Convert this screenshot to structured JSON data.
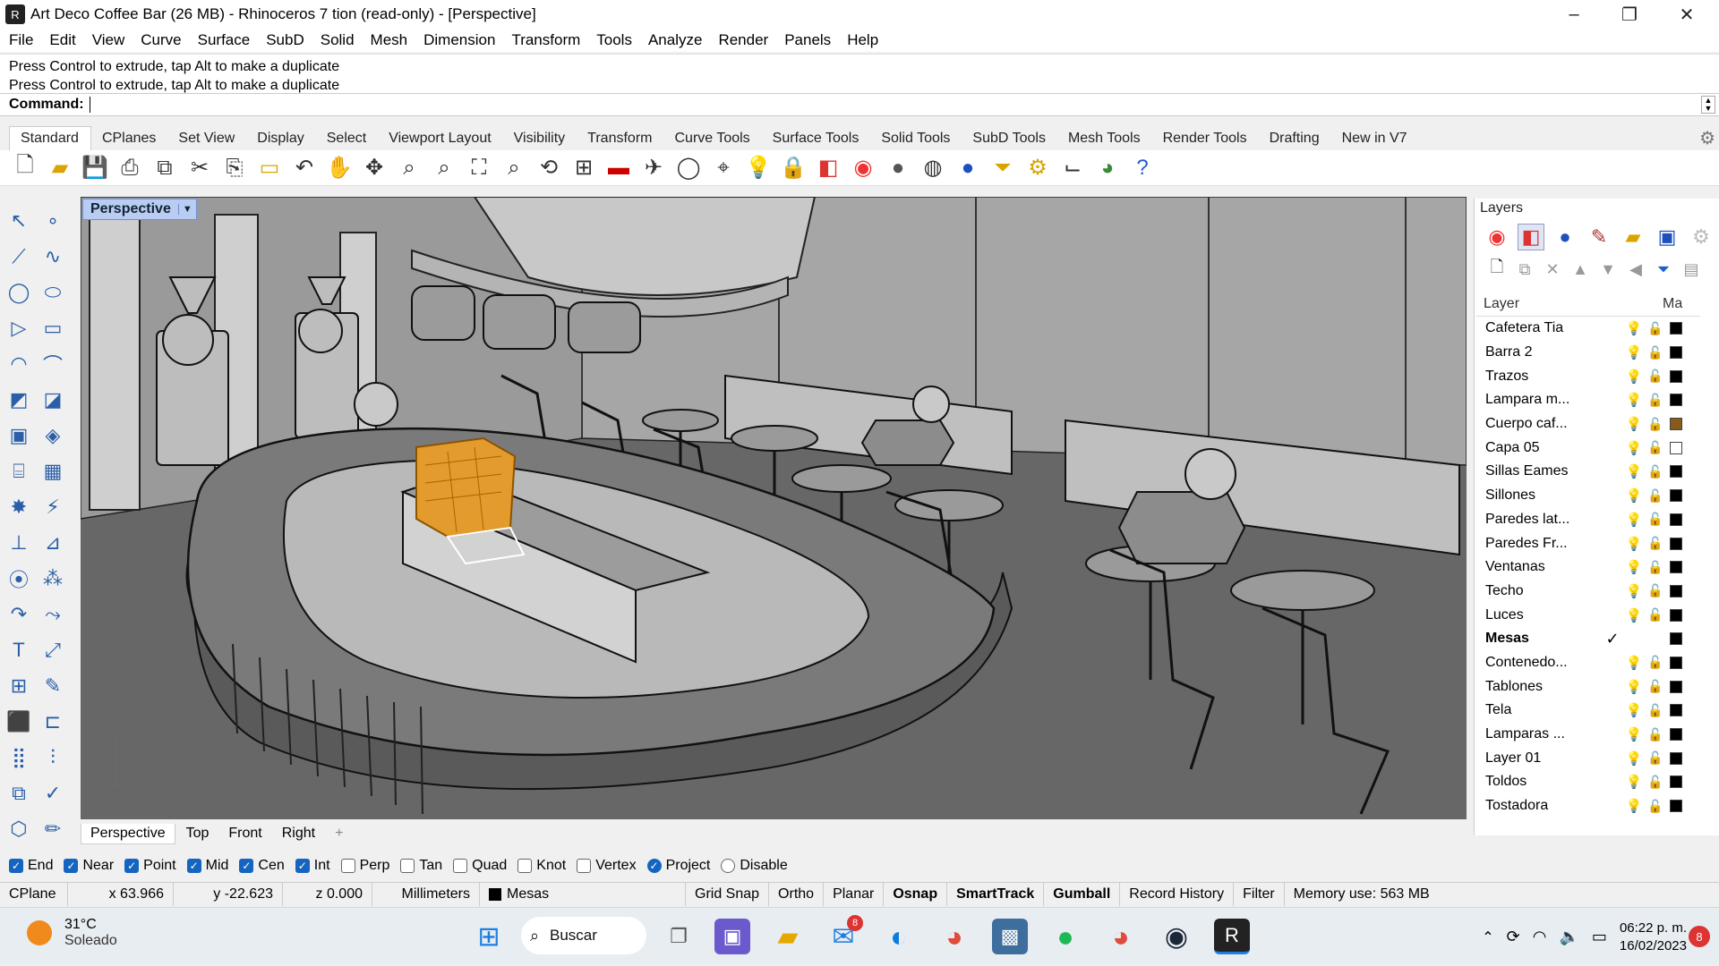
{
  "window": {
    "title": "Art Deco Coffee Bar (26 MB) - Rhinoceros 7 tion (read-only) - [Perspective]",
    "minimize": "–",
    "maximize": "❐",
    "close": "✕"
  },
  "menu": [
    "File",
    "Edit",
    "View",
    "Curve",
    "Surface",
    "SubD",
    "Solid",
    "Mesh",
    "Dimension",
    "Transform",
    "Tools",
    "Analyze",
    "Render",
    "Panels",
    "Help"
  ],
  "command": {
    "history": [
      "Press Control to extrude, tap Alt to make a duplicate",
      "Press Control to extrude, tap Alt to make a duplicate"
    ],
    "label": "Command:"
  },
  "toolbar_tabs": [
    "Standard",
    "CPlanes",
    "Set View",
    "Display",
    "Select",
    "Viewport Layout",
    "Visibility",
    "Transform",
    "Curve Tools",
    "Surface Tools",
    "Solid Tools",
    "SubD Tools",
    "Mesh Tools",
    "Render Tools",
    "Drafting",
    "New in V7"
  ],
  "toolbar_icons": [
    "new-file",
    "open-folder",
    "save",
    "print",
    "import",
    "cut",
    "copy",
    "paste",
    "undo",
    "pan-hand",
    "rotate",
    "zoom",
    "zoom-window",
    "zoom-extents",
    "zoom-selected",
    "rotate-view",
    "four-viewports",
    "car",
    "plane",
    "cplane",
    "object-snap",
    "light-bulb",
    "lock",
    "layers",
    "color-wheel",
    "material-ball",
    "rendered-ball",
    "blue-ball",
    "filter",
    "gear",
    "dimensions",
    "globe",
    "help"
  ],
  "viewport": {
    "name": "Perspective",
    "tabs": [
      "Perspective",
      "Top",
      "Front",
      "Right"
    ],
    "add_tab": "+"
  },
  "layers_panel": {
    "title": "Layers",
    "col_layer": "Layer",
    "col_material": "Ma",
    "current_check": "✓",
    "rows": [
      {
        "name": "Cafetera Tia",
        "color": "#000000"
      },
      {
        "name": "Barra 2",
        "color": "#000000"
      },
      {
        "name": "Trazos",
        "color": "#000000"
      },
      {
        "name": "Lampara m...",
        "color": "#000000"
      },
      {
        "name": "Cuerpo caf...",
        "color": "#8a5a1a"
      },
      {
        "name": "Capa 05",
        "color": "#ffffff"
      },
      {
        "name": "Sillas Eames",
        "color": "#000000"
      },
      {
        "name": "Sillones",
        "color": "#000000"
      },
      {
        "name": "Paredes lat...",
        "color": "#000000"
      },
      {
        "name": "Paredes Fr...",
        "color": "#000000"
      },
      {
        "name": "Ventanas",
        "color": "#000000"
      },
      {
        "name": "Techo",
        "color": "#000000"
      },
      {
        "name": "Luces",
        "color": "#000000"
      },
      {
        "name": "Mesas",
        "color": "#000000",
        "current": true
      },
      {
        "name": "Contenedo...",
        "color": "#000000"
      },
      {
        "name": "Tablones",
        "color": "#000000"
      },
      {
        "name": "Tela",
        "color": "#000000"
      },
      {
        "name": "Lamparas ...",
        "color": "#000000"
      },
      {
        "name": "Layer 01",
        "color": "#000000"
      },
      {
        "name": "Toldos",
        "color": "#000000"
      },
      {
        "name": "Tostadora",
        "color": "#000000"
      }
    ]
  },
  "osnaps": [
    {
      "label": "End",
      "on": true
    },
    {
      "label": "Near",
      "on": true
    },
    {
      "label": "Point",
      "on": true
    },
    {
      "label": "Mid",
      "on": true
    },
    {
      "label": "Cen",
      "on": true
    },
    {
      "label": "Int",
      "on": true
    },
    {
      "label": "Perp",
      "on": false
    },
    {
      "label": "Tan",
      "on": false
    },
    {
      "label": "Quad",
      "on": false
    },
    {
      "label": "Knot",
      "on": false
    },
    {
      "label": "Vertex",
      "on": false
    },
    {
      "label": "Project",
      "on": true,
      "radio": true
    },
    {
      "label": "Disable",
      "on": false,
      "radio": true
    }
  ],
  "status": {
    "cplane": "CPlane",
    "x": "x 63.966",
    "y": "y -22.623",
    "z": "z 0.000",
    "units": "Millimeters",
    "layer": "Mesas",
    "grid_snap": "Grid Snap",
    "ortho": "Ortho",
    "planar": "Planar",
    "osnap": "Osnap",
    "smarttrack": "SmartTrack",
    "gumball": "Gumball",
    "record_history": "Record History",
    "filter": "Filter",
    "memory": "Memory use: 563 MB"
  },
  "taskbar": {
    "temp": "31°C",
    "weather": "Soleado",
    "search": "Buscar",
    "mail_badge": "8",
    "time": "06:22 p. m.",
    "date": "16/02/2023",
    "notif_count": "8"
  }
}
